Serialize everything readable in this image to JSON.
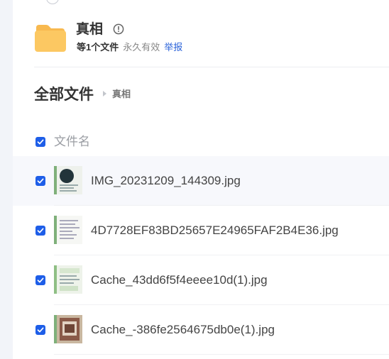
{
  "share": {
    "name": "真相",
    "file_count": "等1个文件",
    "expiry": "永久有效",
    "report_label": "举报"
  },
  "breadcrumb": {
    "root": "全部文件",
    "current": "真相"
  },
  "list_header": {
    "name_column": "文件名"
  },
  "files": [
    {
      "name": "IMG_20231209_144309.jpg",
      "selected": true
    },
    {
      "name": "4D7728EF83BD25657E24965FAF2B4E36.jpg",
      "selected": true
    },
    {
      "name": "Cache_43dd6f5f4eeee10d(1).jpg",
      "selected": true
    },
    {
      "name": "Cache_-386fe2564675db0e(1).jpg",
      "selected": true
    }
  ],
  "colors": {
    "accent": "#1e5ee8",
    "link": "#2b63d9",
    "folder": "#fcc862"
  }
}
